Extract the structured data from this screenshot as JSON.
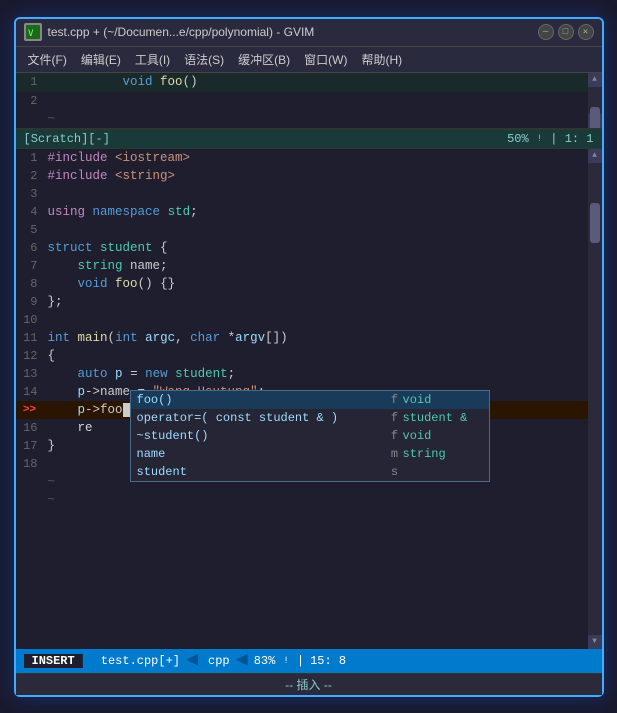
{
  "window": {
    "title": "test.cpp + (~/Documen...e/cpp/polynomial) - GVIM",
    "icon": "vim"
  },
  "titlebar": {
    "buttons": [
      "minimize",
      "maximize",
      "close"
    ]
  },
  "menubar": {
    "items": [
      "文件(F)",
      "编辑(E)",
      "工具(I)",
      "语法(S)",
      "缓冲区(B)",
      "窗口(W)",
      "帮助(H)"
    ]
  },
  "top_editor": {
    "line1": "1  void foo()",
    "line2": "2",
    "status": "50%",
    "pos": "1:  1"
  },
  "scratch_tab": {
    "label": "[Scratch][-]",
    "percent": "50%",
    "pos": "1:  1"
  },
  "code_lines": [
    {
      "num": "1",
      "content": "#include <iostream>",
      "type": "include"
    },
    {
      "num": "2",
      "content": "#include <string>",
      "type": "include"
    },
    {
      "num": "3",
      "content": "",
      "type": "blank"
    },
    {
      "num": "4",
      "content": "using namespace std;",
      "type": "using"
    },
    {
      "num": "5",
      "content": "",
      "type": "blank"
    },
    {
      "num": "6",
      "content": "struct student {",
      "type": "struct"
    },
    {
      "num": "7",
      "content": "    string name;",
      "type": "member"
    },
    {
      "num": "8",
      "content": "    void foo() {}",
      "type": "method"
    },
    {
      "num": "9",
      "content": "};",
      "type": "close"
    },
    {
      "num": "10",
      "content": "",
      "type": "blank"
    },
    {
      "num": "11",
      "content": "int main(int argc, char *argv[])",
      "type": "main"
    },
    {
      "num": "12",
      "content": "{",
      "type": "brace"
    },
    {
      "num": "13",
      "content": "    auto p = new student;",
      "type": "code"
    },
    {
      "num": "14",
      "content": "    p->name = \"Wang Hsutung\";",
      "type": "code"
    },
    {
      "num": "15",
      "content": "    p->foo",
      "type": "code",
      "current": true
    },
    {
      "num": "16",
      "content": "    re",
      "type": "code"
    },
    {
      "num": "17",
      "content": "}",
      "type": "code"
    },
    {
      "num": "18",
      "content": "",
      "type": "blank"
    }
  ],
  "autocomplete": {
    "items": [
      {
        "name": "foo()",
        "type_char": "f",
        "type_name": "void",
        "selected": true
      },
      {
        "name": "operator=( const student & )",
        "type_char": "f",
        "type_name": "student &"
      },
      {
        "name": "~student()",
        "type_char": "f",
        "type_name": "void"
      },
      {
        "name": "name",
        "type_char": "m",
        "type_name": "string"
      },
      {
        "name": "student",
        "type_char": "s",
        "type_name": ""
      }
    ]
  },
  "statusbar": {
    "mode": "INSERT",
    "filename": "test.cpp[+]",
    "filetype": "cpp",
    "percent": "83%",
    "pos": "15:  8"
  },
  "bottombar": {
    "text": "-- 插入 --"
  }
}
